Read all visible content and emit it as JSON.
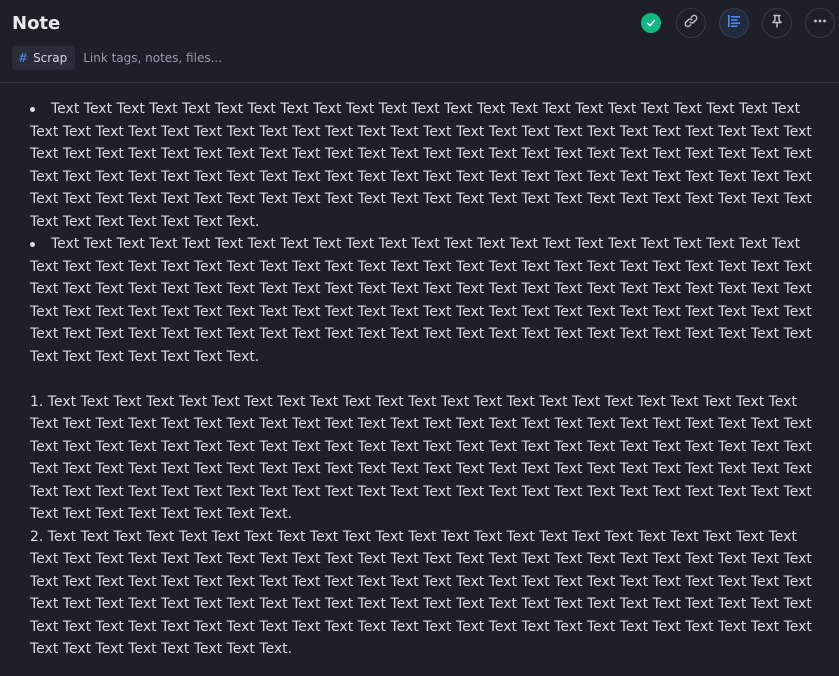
{
  "header": {
    "title": "Note"
  },
  "toolbar": {
    "status_icon": "check-circle-icon",
    "buttons": [
      {
        "icon": "link-icon"
      },
      {
        "icon": "align-left-icon"
      },
      {
        "icon": "pin-icon"
      },
      {
        "icon": "more-horizontal-icon"
      }
    ]
  },
  "tags": {
    "chip_label": "Scrap",
    "chip_hash": "#",
    "input_placeholder": "Link tags, notes, files..."
  },
  "content": {
    "bullets": [
      "Text Text Text Text Text Text Text Text Text Text Text Text Text Text Text Text Text Text Text Text Text Text Text Text Text Text Text Text Text Text Text Text Text Text Text Text Text Text Text Text Text Text Text Text Text Text Text Text Text Text Text Text Text Text Text Text Text Text Text Text Text Text Text Text Text Text Text Text Text Text Text Text Text Text Text Text Text Text Text Text Text Text Text Text Text Text Text Text Text Text Text Text Text Text Text Text Text Text Text Text Text Text Text Text Text Text Text Text Text Text Text Text Text Text Text Text Text Text Text Text Text Text Text Text Text Text.",
      "Text Text Text Text Text Text Text Text Text Text Text Text Text Text Text Text Text Text Text Text Text Text Text Text Text Text Text Text Text Text Text Text Text Text Text Text Text Text Text Text Text Text Text Text Text Text Text Text Text Text Text Text Text Text Text Text Text Text Text Text Text Text Text Text Text Text Text Text Text Text Text Text Text Text Text Text Text Text Text Text Text Text Text Text Text Text Text Text Text Text Text Text Text Text Text Text Text Text Text Text Text Text Text Text Text Text Text Text Text Text Text Text Text Text Text Text Text Text Text Text Text Text Text Text Text Text."
    ],
    "numbered": [
      "1. Text Text Text Text Text Text Text Text Text Text Text Text Text Text Text Text Text Text Text Text Text Text Text Text Text Text Text Text Text Text Text Text Text Text Text Text Text Text Text Text Text Text Text Text Text Text Text Text Text Text Text Text Text Text Text Text Text Text Text Text Text Text Text Text Text Text Text Text Text Text Text Text Text Text Text Text Text Text Text Text Text Text Text Text Text Text Text Text Text Text Text Text Text Text Text Text Text Text Text Text Text Text Text Text Text Text Text Text Text Text Text Text Text Text Text Text Text Text Text Text Text Text Text Text Text Text Text.",
      "2. Text Text Text Text Text Text Text Text Text Text Text Text Text Text Text Text Text Text Text Text Text Text Text Text Text Text Text Text Text Text Text Text Text Text Text Text Text Text Text Text Text Text Text Text Text Text Text Text Text Text Text Text Text Text Text Text Text Text Text Text Text Text Text Text Text Text Text Text Text Text Text Text Text Text Text Text Text Text Text Text Text Text Text Text Text Text Text Text Text Text Text Text Text Text Text Text Text Text Text Text Text Text Text Text Text Text Text Text Text Text Text Text Text Text Text Text Text Text Text Text Text Text Text Text Text Text Text."
    ]
  },
  "colors": {
    "background": "#1e1f29",
    "accent": "#4c8bf5",
    "success": "#10b981"
  }
}
